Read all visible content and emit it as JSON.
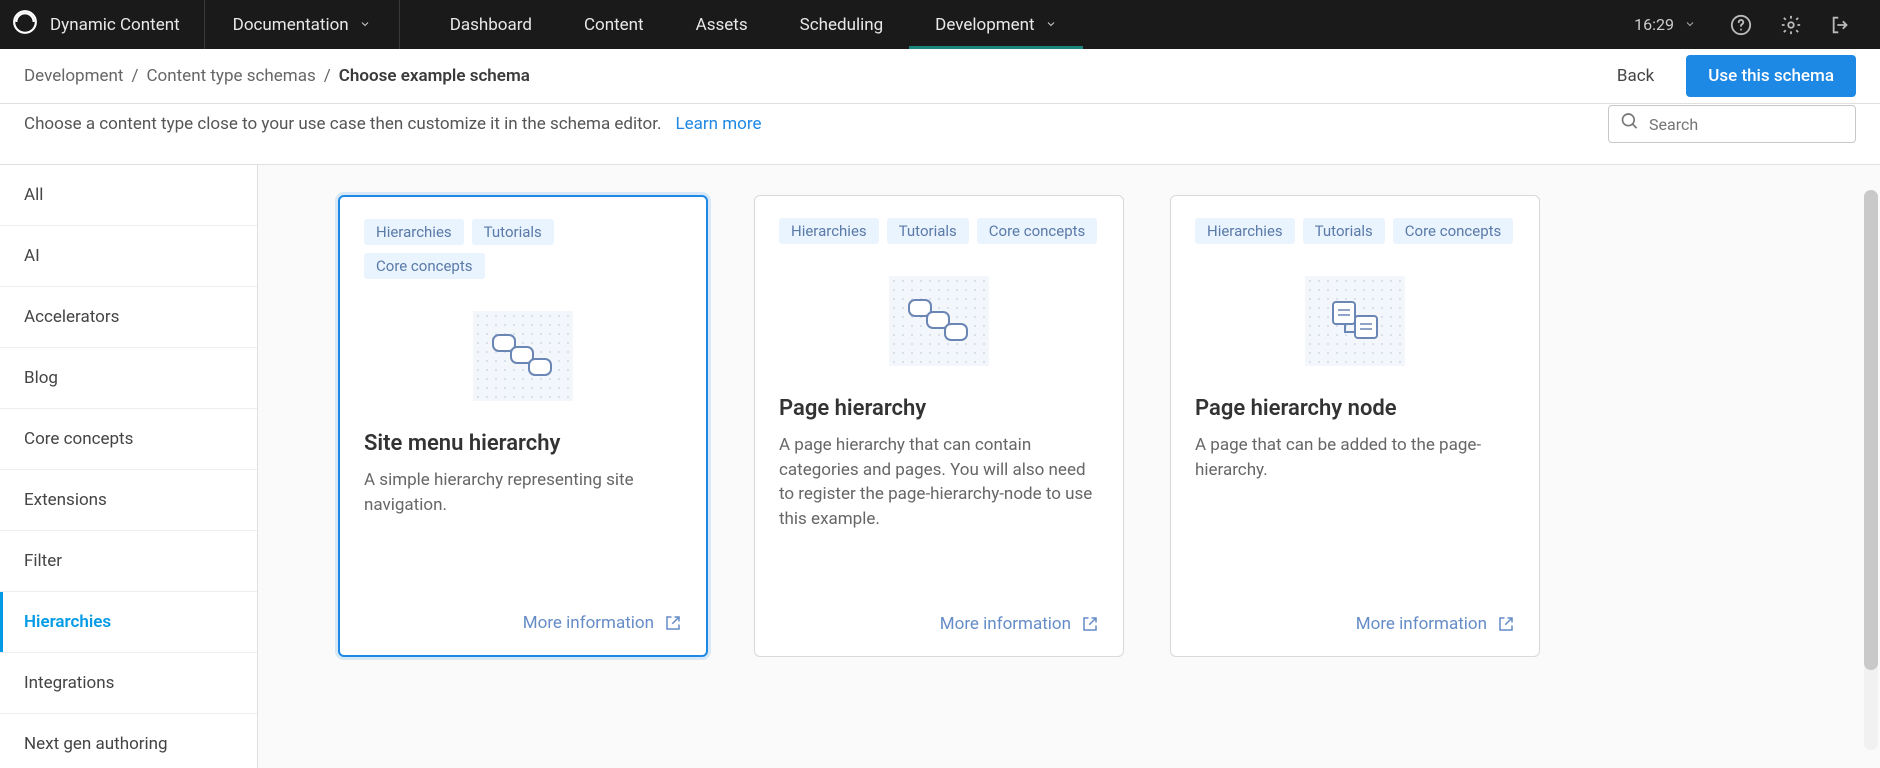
{
  "topbar": {
    "brand": "Dynamic Content",
    "hub": "Documentation",
    "nav": [
      "Dashboard",
      "Content",
      "Assets",
      "Scheduling",
      "Development"
    ],
    "nav_active_index": 4,
    "time": "16:29"
  },
  "breadcrumb": {
    "items": [
      "Development",
      "Content type schemas",
      "Choose example schema"
    ],
    "back_label": "Back",
    "primary_label": "Use this schema"
  },
  "info": {
    "text": "Choose a content type close to your use case then customize it in the schema editor.",
    "learn_more": "Learn more",
    "search_placeholder": "Search"
  },
  "sidebar": {
    "items": [
      "All",
      "AI",
      "Accelerators",
      "Blog",
      "Core concepts",
      "Extensions",
      "Filter",
      "Hierarchies",
      "Integrations",
      "Next gen authoring"
    ],
    "active_index": 7
  },
  "cards": [
    {
      "tags": [
        "Hierarchies",
        "Tutorials",
        "Core concepts"
      ],
      "title": "Site menu hierarchy",
      "desc": "A simple hierarchy representing site navigation.",
      "more": "More information",
      "selected": true,
      "illus": "chain"
    },
    {
      "tags": [
        "Hierarchies",
        "Tutorials",
        "Core concepts"
      ],
      "title": "Page hierarchy",
      "desc": "A page hierarchy that can contain categories and pages. You will also need to register the page-hierarchy-node to use this example.",
      "more": "More information",
      "selected": false,
      "illus": "chain"
    },
    {
      "tags": [
        "Hierarchies",
        "Tutorials",
        "Core concepts"
      ],
      "title": "Page hierarchy node",
      "desc": "A page that can be added to the page-hierarchy.",
      "more": "More information",
      "selected": false,
      "illus": "node"
    }
  ]
}
